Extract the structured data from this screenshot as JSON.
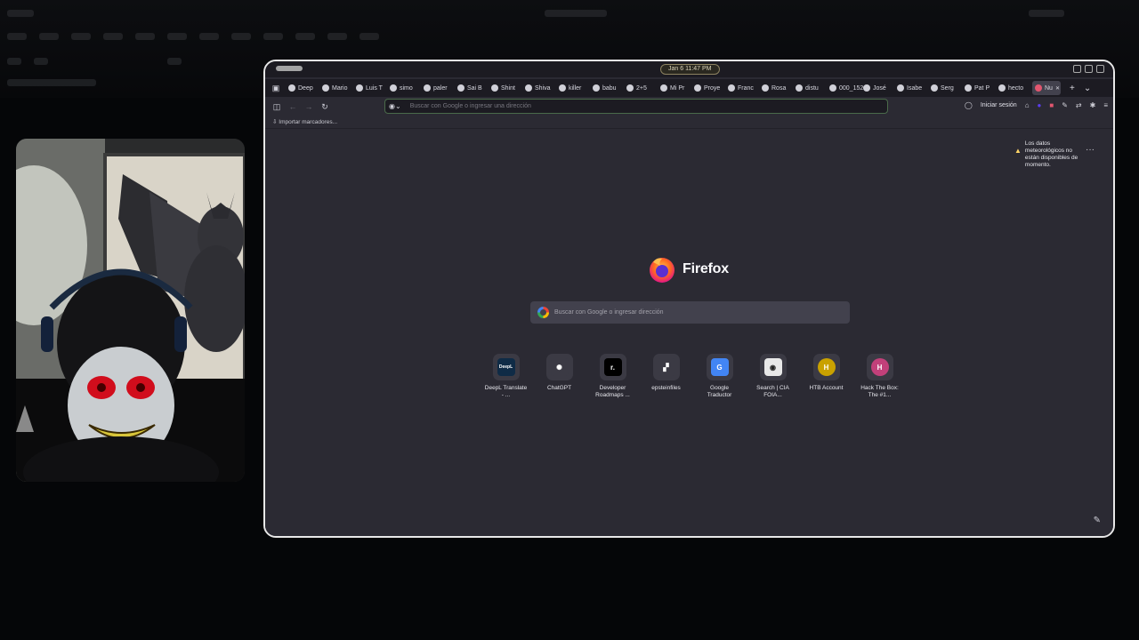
{
  "system_bar": {
    "clock": "Jan 6  11:47 PM"
  },
  "tabs": [
    {
      "label": "Deep"
    },
    {
      "label": "Mario"
    },
    {
      "label": "Luis T"
    },
    {
      "label": "simo"
    },
    {
      "label": "paler"
    },
    {
      "label": "Sai B"
    },
    {
      "label": "Shint"
    },
    {
      "label": "Shiva"
    },
    {
      "label": "killer"
    },
    {
      "label": "babu"
    },
    {
      "label": "2+5"
    },
    {
      "label": "Mi Pr"
    },
    {
      "label": "Proye"
    },
    {
      "label": "Franc"
    },
    {
      "label": "Rosa"
    },
    {
      "label": "distu"
    },
    {
      "label": "000_152"
    },
    {
      "label": "José"
    },
    {
      "label": "Isabe"
    },
    {
      "label": "Serg"
    },
    {
      "label": "Pat P"
    },
    {
      "label": "hecto"
    },
    {
      "label": "Nu",
      "active": true
    }
  ],
  "navbar": {
    "url_placeholder": "Buscar con Google o ingresar una dirección",
    "signin": "Iniciar sesión"
  },
  "bookmarks": {
    "import": "Importar marcadores..."
  },
  "newtab": {
    "weather": "Los datos meteorológicos no están disponibles de momento.",
    "brand": "Firefox",
    "search_placeholder": "Buscar con Google o ingresar dirección",
    "shortcuts": [
      {
        "label": "DeepL Translate - ...",
        "icon": "deepl-icon",
        "color": "#0f2b46",
        "glyph": "DeepL"
      },
      {
        "label": "ChatGPT",
        "icon": "chatgpt-icon",
        "color": "#3b3a44",
        "glyph": "✺"
      },
      {
        "label": "Developer Roadmaps ...",
        "icon": "roadmap-icon",
        "color": "#000000",
        "glyph": "r."
      },
      {
        "label": "epsteinfiles",
        "icon": "epstein-icon",
        "color": "#3b3a44",
        "glyph": "▞"
      },
      {
        "label": "Google Traductor",
        "icon": "google-translate-icon",
        "color": "#4285f4",
        "glyph": "G"
      },
      {
        "label": "Search | CIA FOIA...",
        "icon": "cia-icon",
        "color": "#e8e8e8",
        "glyph": "◉"
      },
      {
        "label": "HTB Account",
        "icon": "htb-icon",
        "color": "#c9a100",
        "glyph": "H"
      },
      {
        "label": "Hack The Box: The #1...",
        "icon": "hackthebox-icon",
        "color": "#c2407a",
        "glyph": "H"
      }
    ]
  }
}
